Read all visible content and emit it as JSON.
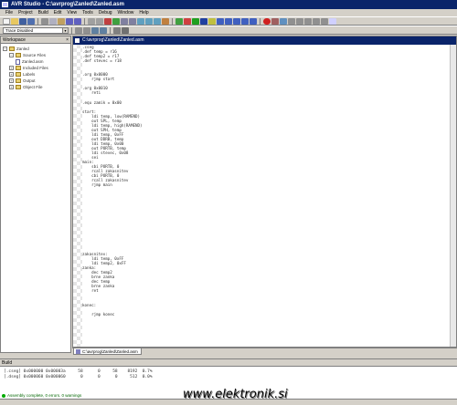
{
  "app": {
    "title": "AVR Studio - C:\\avrprog\\Zanled\\Zanled.asm"
  },
  "menu": [
    "File",
    "Project",
    "Build",
    "Edit",
    "View",
    "Tools",
    "Debug",
    "Window",
    "Help"
  ],
  "toolbar": {
    "target_combo": "Trace Disabled"
  },
  "workspace": {
    "title": "Workspace",
    "close": "×",
    "tree": [
      {
        "label": "Zanled",
        "level": 0,
        "type": "root"
      },
      {
        "label": "Source Files",
        "level": 1,
        "type": "folder"
      },
      {
        "label": "Zanled.asm",
        "level": 2,
        "type": "file"
      },
      {
        "label": "Included Files",
        "level": 1,
        "type": "folder"
      },
      {
        "label": "Labels",
        "level": 1,
        "type": "folder"
      },
      {
        "label": "Output",
        "level": 1,
        "type": "folder"
      },
      {
        "label": "Object File",
        "level": 1,
        "type": "folder"
      }
    ]
  },
  "editor": {
    "title": "C:\\avrprog\\Zanled\\Zanled.asm",
    "code": [
      ".cseg",
      ".def temp = r16",
      ".def temp2 = r17",
      ".def stevec = r18",
      "",
      "",
      ".org 0x0000",
      "    rjmp start",
      "",
      ".org 0x0010",
      "    reti",
      "",
      ".equ zamik = 0x00",
      "",
      "start:",
      "    ldi temp, low(RAMEND)",
      "    out SPL, temp",
      "    ldi temp, high(RAMEND)",
      "    out SPH, temp",
      "    ldi temp, 0xFF",
      "    out DDRB, temp",
      "    ldi temp, 0x00",
      "    out PORTB, temp",
      "    ldi stevec, 0x08",
      "    sei",
      "main:",
      "    sbi PORTB, 0",
      "    rcall zakasnitev",
      "    cbi PORTB, 0",
      "    rcall zakasnitev",
      "    rjmp main",
      "",
      "",
      "",
      "",
      "",
      "",
      "",
      "",
      "",
      "",
      "",
      "",
      "",
      "",
      "zakasnitev:",
      "    ldi temp, 0xFF",
      "    ldi temp2, 0xFF",
      "zanka:",
      "    dec temp2",
      "    brne zanka",
      "    dec temp",
      "    brne zanka",
      "    ret",
      "",
      "",
      "konec:",
      "",
      "    rjmp konec",
      ""
    ]
  },
  "tabs": [
    {
      "label": "C:\\avrprog\\Zanled\\Zanled.asm"
    }
  ],
  "output": {
    "title": "Build",
    "lines": [
      "[.cseg] 0x000000 0x00003a     58      0     58    8192  0.7%",
      "[.dseg] 0x000060 0x000060      0      0      0     512  0.0%"
    ],
    "message": "Assembly complete, 0 errors. 0 warnings"
  },
  "watermark": "www.elektronik.si",
  "colors": {
    "titlebar": "#0a246a",
    "chrome": "#d4d0c8"
  }
}
